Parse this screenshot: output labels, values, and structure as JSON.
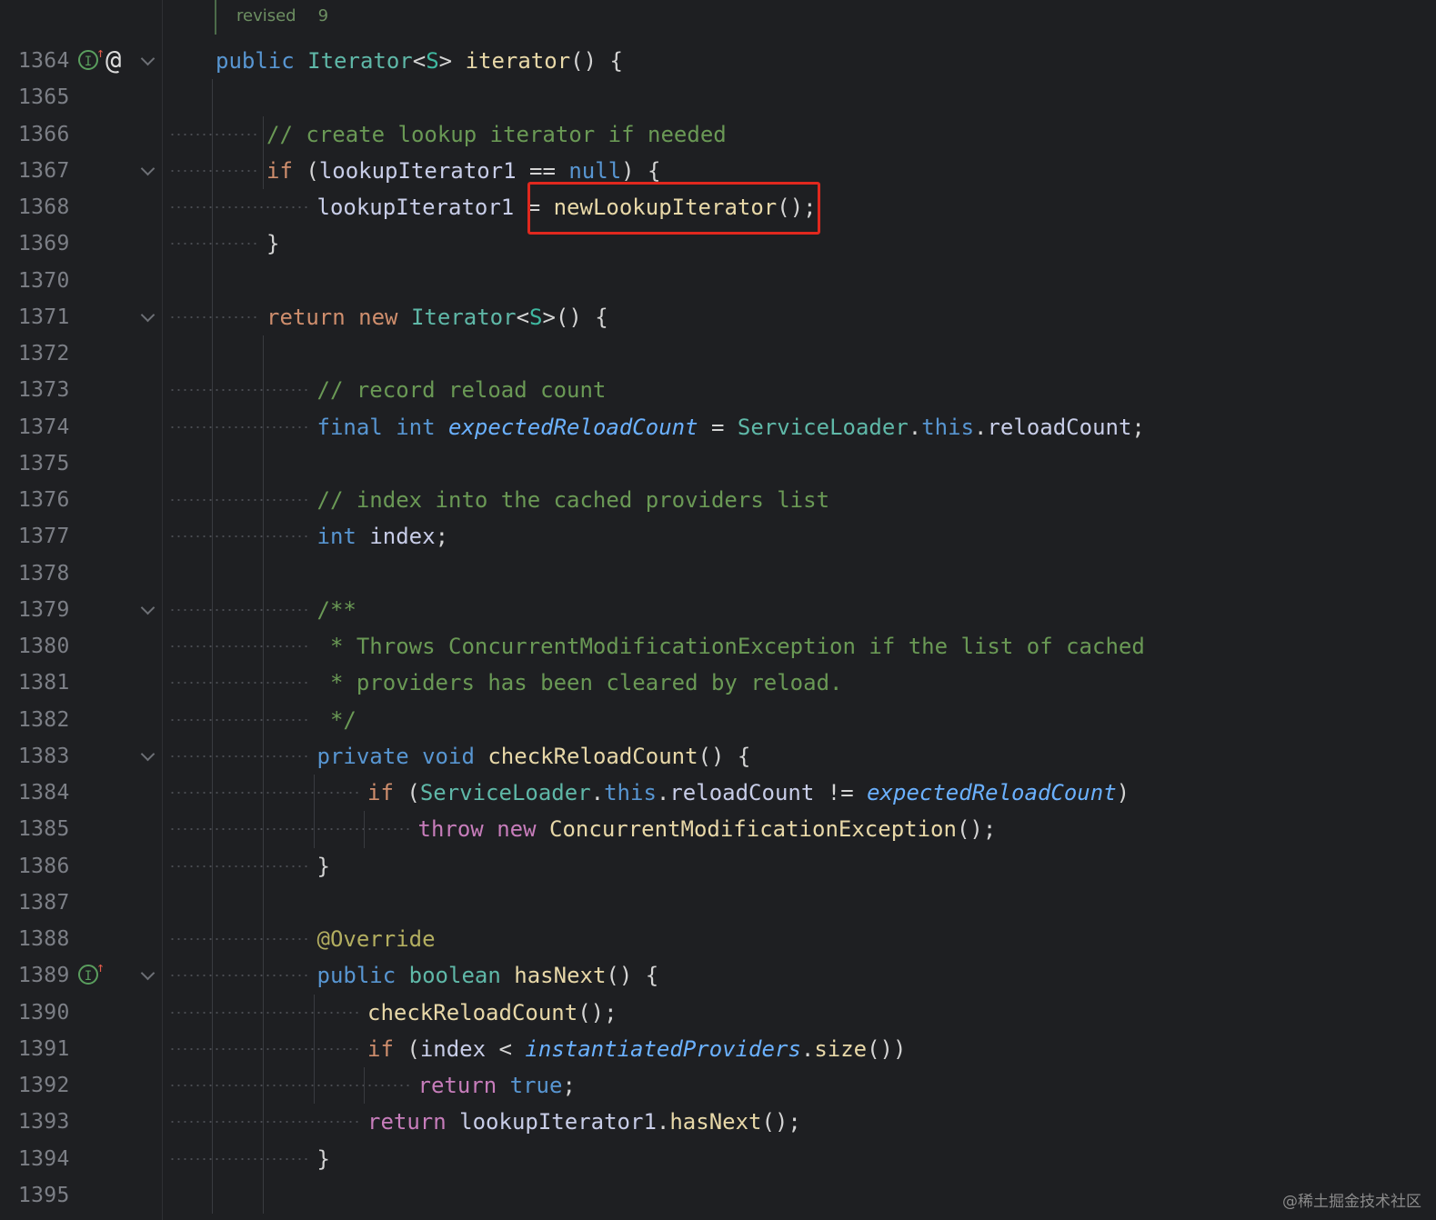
{
  "editor": {
    "revision": {
      "label": "revised",
      "count": "9"
    },
    "watermark": "@稀土掘金技术社区",
    "colors": {
      "background": "#1e1f22",
      "highlight_box": "#e0281e"
    },
    "lines": [
      {
        "number": "1364",
        "icons": [
          "implements-up-icon",
          "at-icon"
        ],
        "fold": true,
        "tokens": [
          [
            "kw2",
            "public"
          ],
          [
            "plain",
            " "
          ],
          [
            "ty",
            "Iterator"
          ],
          [
            "plain",
            "<"
          ],
          [
            "tyg",
            "S"
          ],
          [
            "plain",
            "> "
          ],
          [
            "fn",
            "iterator"
          ],
          [
            "plain",
            "() {"
          ]
        ]
      },
      {
        "number": "1365",
        "tokens": []
      },
      {
        "number": "1366",
        "tokens": [
          [
            "cm",
            "// create lookup iterator if needed"
          ]
        ]
      },
      {
        "number": "1367",
        "fold": true,
        "tokens": [
          [
            "kw",
            "if"
          ],
          [
            "plain",
            " ("
          ],
          [
            "var",
            "lookupIterator1"
          ],
          [
            "plain",
            " == "
          ],
          [
            "kw2",
            "null"
          ],
          [
            "plain",
            ") {"
          ]
        ]
      },
      {
        "number": "1368",
        "tokens": [
          [
            "var",
            "lookupIterator1"
          ],
          [
            "plain",
            " = "
          ],
          [
            "fn",
            "newLookupIterator"
          ],
          [
            "plain",
            "();"
          ]
        ]
      },
      {
        "number": "1369",
        "tokens": [
          [
            "plain",
            "}"
          ]
        ]
      },
      {
        "number": "1370",
        "tokens": []
      },
      {
        "number": "1371",
        "fold": true,
        "tokens": [
          [
            "kw",
            "return"
          ],
          [
            "plain",
            " "
          ],
          [
            "kw",
            "new"
          ],
          [
            "plain",
            " "
          ],
          [
            "ty",
            "Iterator"
          ],
          [
            "plain",
            "<"
          ],
          [
            "tyg",
            "S"
          ],
          [
            "plain",
            ">() {"
          ]
        ]
      },
      {
        "number": "1372",
        "tokens": []
      },
      {
        "number": "1373",
        "tokens": [
          [
            "cm",
            "// record reload count"
          ]
        ]
      },
      {
        "number": "1374",
        "tokens": [
          [
            "kw2",
            "final"
          ],
          [
            "plain",
            " "
          ],
          [
            "kw2",
            "int"
          ],
          [
            "plain",
            " "
          ],
          [
            "fld",
            "expectedReloadCount"
          ],
          [
            "plain",
            " = "
          ],
          [
            "ty",
            "ServiceLoader"
          ],
          [
            "plain",
            "."
          ],
          [
            "kw2",
            "this"
          ],
          [
            "plain",
            "."
          ],
          [
            "var",
            "reloadCount"
          ],
          [
            "plain",
            ";"
          ]
        ]
      },
      {
        "number": "1375",
        "tokens": []
      },
      {
        "number": "1376",
        "tokens": [
          [
            "cm",
            "// index into the cached providers list"
          ]
        ]
      },
      {
        "number": "1377",
        "tokens": [
          [
            "kw2",
            "int"
          ],
          [
            "plain",
            " "
          ],
          [
            "var",
            "index"
          ],
          [
            "plain",
            ";"
          ]
        ]
      },
      {
        "number": "1378",
        "tokens": []
      },
      {
        "number": "1379",
        "fold": true,
        "tokens": [
          [
            "doc",
            "/**"
          ]
        ]
      },
      {
        "number": "1380",
        "tokens": [
          [
            "doc",
            " * Throws ConcurrentModificationException if the list of cached"
          ]
        ]
      },
      {
        "number": "1381",
        "tokens": [
          [
            "doc",
            " * providers has been cleared by reload."
          ]
        ]
      },
      {
        "number": "1382",
        "tokens": [
          [
            "doc",
            " */"
          ]
        ]
      },
      {
        "number": "1383",
        "fold": true,
        "tokens": [
          [
            "kw2",
            "private"
          ],
          [
            "plain",
            " "
          ],
          [
            "kw2",
            "void"
          ],
          [
            "plain",
            " "
          ],
          [
            "fn",
            "checkReloadCount"
          ],
          [
            "plain",
            "() {"
          ]
        ]
      },
      {
        "number": "1384",
        "tokens": [
          [
            "kw",
            "if"
          ],
          [
            "plain",
            " ("
          ],
          [
            "ty",
            "ServiceLoader"
          ],
          [
            "plain",
            "."
          ],
          [
            "kw2",
            "this"
          ],
          [
            "plain",
            "."
          ],
          [
            "var",
            "reloadCount"
          ],
          [
            "plain",
            " != "
          ],
          [
            "fld",
            "expectedReloadCount"
          ],
          [
            "plain",
            ")"
          ]
        ]
      },
      {
        "number": "1385",
        "tokens": [
          [
            "kp",
            "throw"
          ],
          [
            "plain",
            " "
          ],
          [
            "kp",
            "new"
          ],
          [
            "plain",
            " "
          ],
          [
            "fn",
            "ConcurrentModificationException"
          ],
          [
            "plain",
            "();"
          ]
        ]
      },
      {
        "number": "1386",
        "tokens": [
          [
            "plain",
            "}"
          ]
        ]
      },
      {
        "number": "1387",
        "tokens": []
      },
      {
        "number": "1388",
        "tokens": [
          [
            "ann",
            "@Override"
          ]
        ]
      },
      {
        "number": "1389",
        "icons": [
          "implements-up-icon"
        ],
        "fold": true,
        "tokens": [
          [
            "kw2",
            "public"
          ],
          [
            "plain",
            " "
          ],
          [
            "ty",
            "boolean"
          ],
          [
            "plain",
            " "
          ],
          [
            "fn",
            "hasNext"
          ],
          [
            "plain",
            "() {"
          ]
        ]
      },
      {
        "number": "1390",
        "tokens": [
          [
            "fn",
            "checkReloadCount"
          ],
          [
            "plain",
            "();"
          ]
        ]
      },
      {
        "number": "1391",
        "tokens": [
          [
            "kw",
            "if"
          ],
          [
            "plain",
            " ("
          ],
          [
            "var",
            "index"
          ],
          [
            "plain",
            " < "
          ],
          [
            "fld",
            "instantiatedProviders"
          ],
          [
            "plain",
            "."
          ],
          [
            "fn",
            "size"
          ],
          [
            "plain",
            "())"
          ]
        ]
      },
      {
        "number": "1392",
        "tokens": [
          [
            "kp",
            "return"
          ],
          [
            "plain",
            " "
          ],
          [
            "kw2",
            "true"
          ],
          [
            "plain",
            ";"
          ]
        ]
      },
      {
        "number": "1393",
        "tokens": [
          [
            "kp",
            "return"
          ],
          [
            "plain",
            " "
          ],
          [
            "var",
            "lookupIterator1"
          ],
          [
            "plain",
            "."
          ],
          [
            "fn",
            "hasNext"
          ],
          [
            "plain",
            "();"
          ]
        ]
      },
      {
        "number": "1394",
        "tokens": [
          [
            "plain",
            "}"
          ]
        ]
      },
      {
        "number": "1395",
        "tokens": []
      }
    ]
  }
}
